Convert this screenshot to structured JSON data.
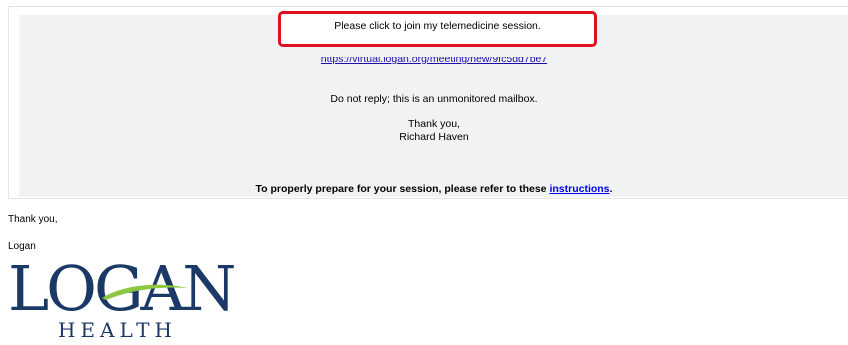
{
  "email": {
    "join_text": "Please click to join my telemedicine session.",
    "meeting_url": "https://virtual.logan.org/meeting/new/9fc5dd7be7",
    "no_reply": "Do not reply; this is an unmonitored mailbox.",
    "closing": "Thank you,",
    "sender_name": "Richard Haven",
    "prepare_text": "To properly prepare for your session, please refer to these ",
    "instructions_link": "instructions",
    "prepare_suffix": "."
  },
  "signature": {
    "thanks": "Thank you,",
    "org": "Logan"
  },
  "logo": {
    "wordmark": "LOGAN",
    "subtitle": "HEALTH"
  },
  "colors": {
    "annotation": "#e0101f",
    "link": "#1a0dab",
    "logo_navy": "#1b3966",
    "logo_green": "#8dc63f"
  }
}
